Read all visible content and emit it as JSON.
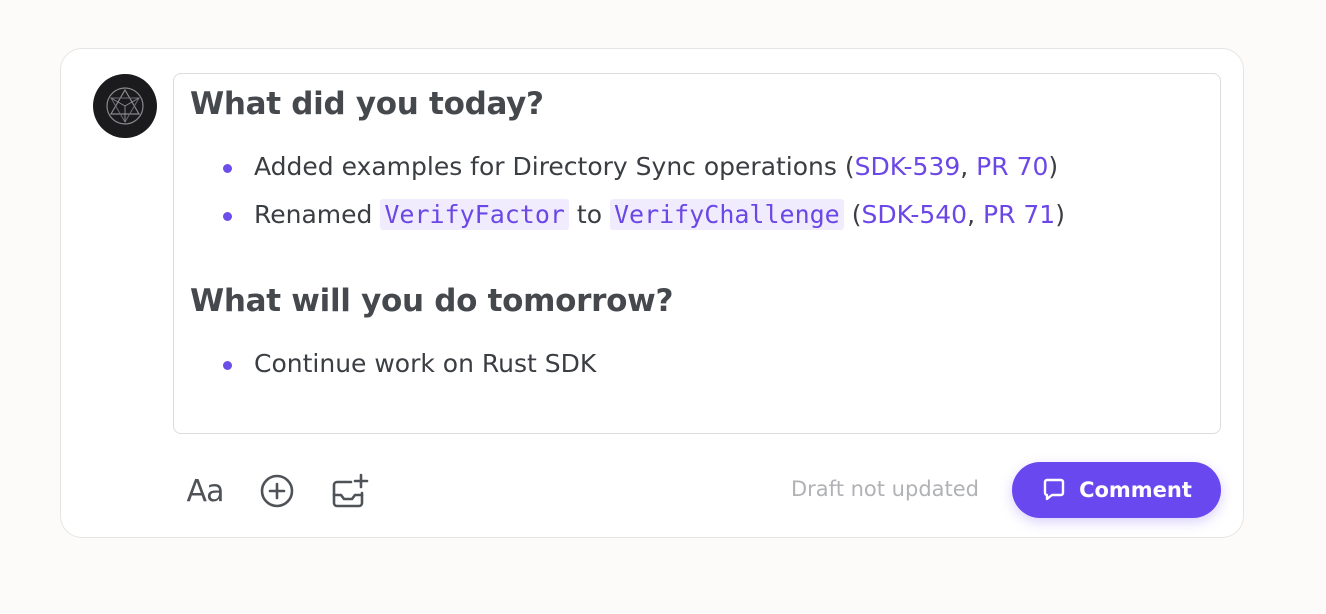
{
  "editor": {
    "sections": [
      {
        "heading": "What did you today?",
        "items": [
          {
            "text": "Added examples for Directory Sync operations (",
            "link1": "SDK-539",
            "sep": ", ",
            "link2": "PR 70",
            "end": ")"
          },
          {
            "text1": "Renamed ",
            "code1": "VerifyFactor",
            "text2": " to ",
            "code2": "VerifyChallenge",
            "text3": " (",
            "link1": "SDK-540",
            "sep": ", ",
            "link2": "PR 71",
            "end": ")"
          }
        ]
      },
      {
        "heading": "What will you do tomorrow?",
        "items": [
          {
            "text": "Continue work on Rust SDK"
          }
        ]
      }
    ]
  },
  "toolbar": {
    "text_format_label": "Aa",
    "text_format_icon": "text-format-icon",
    "add_icon": "plus-circle-icon",
    "media_icon": "add-image-icon"
  },
  "status": "Draft not updated",
  "comment_button": {
    "label": "Comment",
    "icon": "speech-bubble-icon"
  },
  "colors": {
    "accent": "#6a48f0",
    "link": "#6b47e6",
    "code_bg": "#f0ecfd",
    "text": "#3a3d42",
    "heading": "#45484c",
    "muted": "#b0b2b5"
  }
}
